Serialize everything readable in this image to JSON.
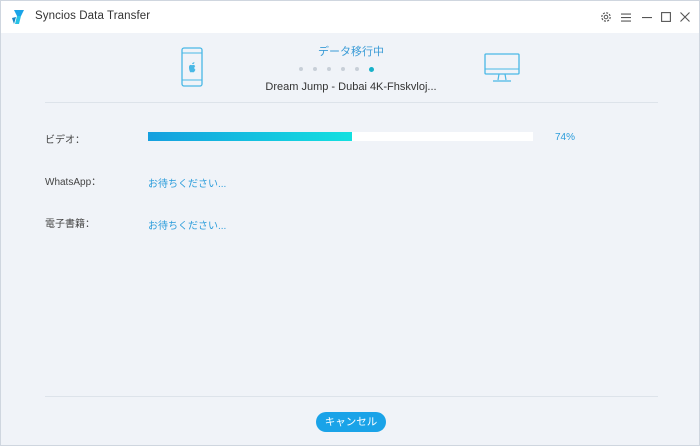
{
  "window": {
    "title": "Syncios Data Transfer"
  },
  "transfer": {
    "status": "データ移行中",
    "current_item": "Dream Jump - Dubai 4K-Fhskvloj...",
    "steps_total": 6,
    "step_active": 6
  },
  "rows": [
    {
      "label": "ビデオ：",
      "progress": 74,
      "progress_text": "74%"
    },
    {
      "label": "WhatsApp：",
      "status": "お待ちください..."
    },
    {
      "label": "電子書籍：",
      "status": "お待ちください..."
    }
  ],
  "footer": {
    "cancel_label": "キャンセル"
  },
  "colors": {
    "accent": "#1aa3e8",
    "progress_start": "#159fdf",
    "progress_end": "#13e0e0",
    "status_text": "#2c9ddb"
  },
  "icons": {
    "logo": "syncios-logo-icon",
    "settings": "gear-icon",
    "menu": "menu-icon",
    "minimize": "minimize-icon",
    "maximize": "maximize-icon",
    "close": "close-icon",
    "source": "phone-icon",
    "target": "computer-icon"
  }
}
